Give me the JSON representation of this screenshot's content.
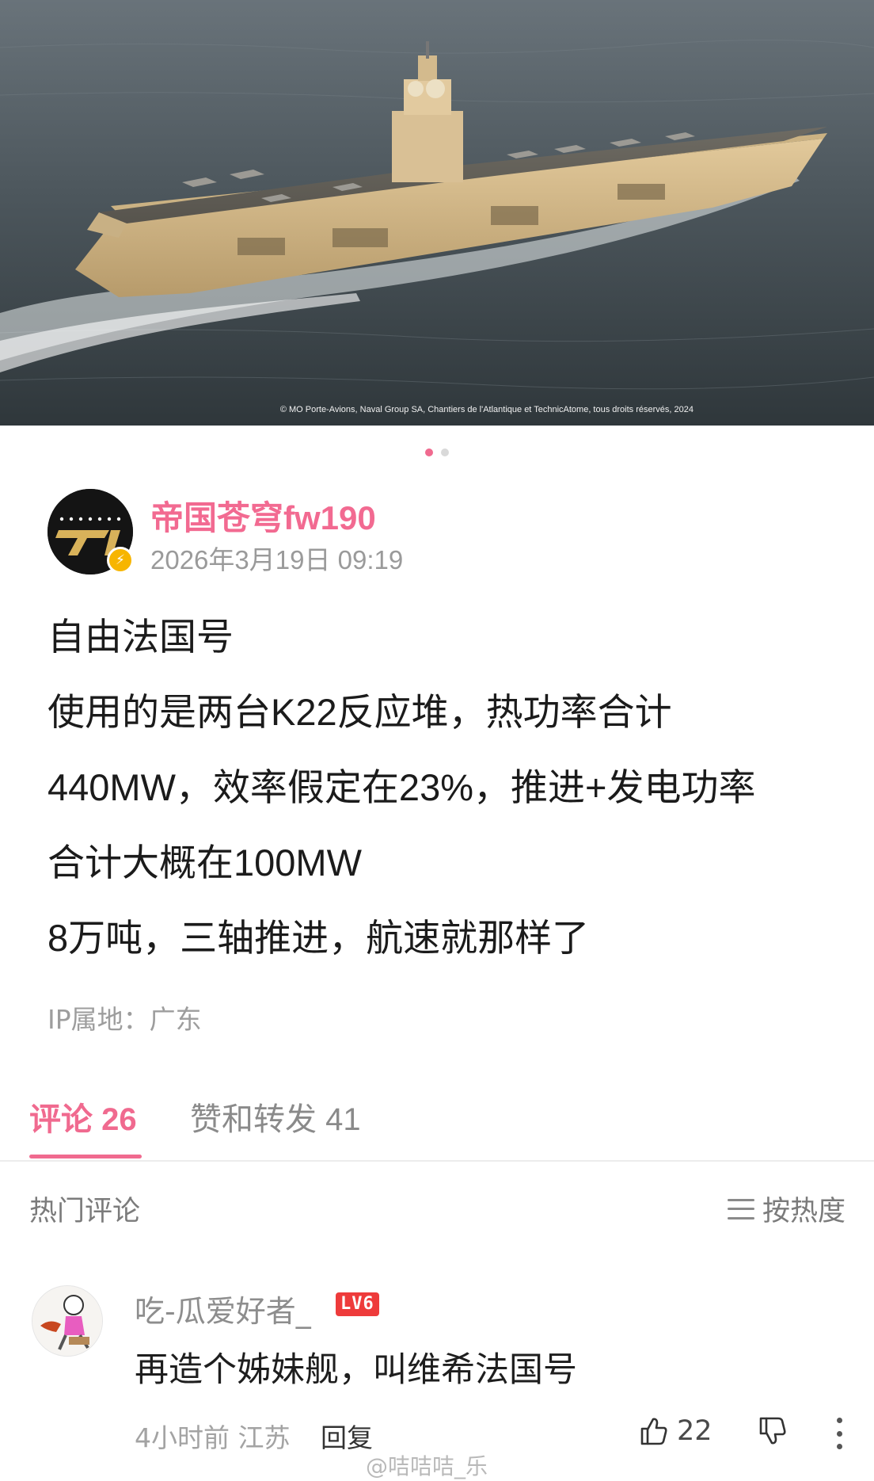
{
  "image": {
    "credit": "© MO Porte-Avions, Naval Group SA, Chantiers de l'Atlantique et TechnicAtome, tous droits réservés, 2024",
    "carousel_total": 2,
    "carousel_active": 1
  },
  "post": {
    "author": "帝国苍穹fw190",
    "time": "2026年3月19日 09:19",
    "lines": [
      "自由法国号",
      "使用的是两台K22反应堆，热功率合计",
      "440MW，效率假定在23%，推进+发电功率",
      "合计大概在100MW",
      "8万吨，三轴推进，航速就那样了"
    ],
    "ip_location": "IP属地：广东"
  },
  "tabs": {
    "comments": "评论 26",
    "likes_reposts": "赞和转发 41"
  },
  "comments_section": {
    "title": "热门评论",
    "sort_label": "按热度"
  },
  "comment": {
    "user": "吃-瓜爱好者_",
    "level": "LV6",
    "text": "再造个姊妹舰，叫维希法国号",
    "time_location": "4小时前 江苏",
    "reply": "回复",
    "likes": "22"
  },
  "watermark": "@咭咭咭_乐",
  "colors": {
    "accent": "#f06a8f",
    "author_name": "#f26a91",
    "level_badge": "#ee3b3b",
    "verify_badge": "#f7b500"
  }
}
